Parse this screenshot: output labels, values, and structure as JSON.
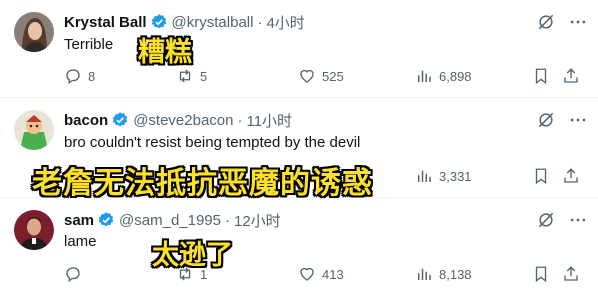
{
  "tweets": [
    {
      "name": "Krystal Ball",
      "handle": "@krystalball",
      "dot": "·",
      "time": "4小时",
      "text": "Terrible",
      "replies": "8",
      "retweets": "5",
      "likes": "525",
      "views": "6,898"
    },
    {
      "name": "bacon",
      "handle": "@steve2bacon",
      "dot": "·",
      "time": "11小时",
      "text": "bro couldn't resist being tempted by the devil",
      "views": "3,331"
    },
    {
      "name": "sam",
      "handle": "@sam_d_1995",
      "dot": "·",
      "time": "12小时",
      "text": "lame",
      "retweets": "1",
      "likes": "413",
      "views": "8,138"
    }
  ],
  "overlays": {
    "caption1": "糟糕",
    "caption2": "老詹无法抵抗恶魔的诱惑",
    "caption3": "太逊了"
  },
  "colors": {
    "verified_blue": "#1d9bf0",
    "muted_gray": "#536471",
    "caption_yellow": "#fde02a"
  },
  "icons": [
    "verified-badge-icon",
    "mute-icon",
    "more-icon",
    "reply-icon",
    "retweet-icon",
    "like-icon",
    "views-icon",
    "bookmark-icon",
    "share-icon"
  ]
}
